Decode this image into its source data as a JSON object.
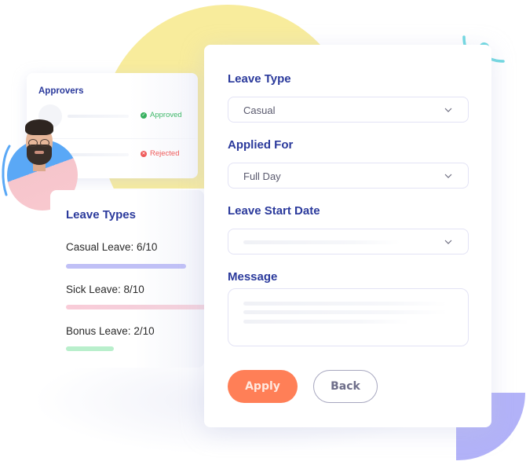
{
  "colors": {
    "heading": "#2b3a9c",
    "apply_button": "#ff7f57",
    "approved": "#36b05e",
    "rejected": "#ef5a5a",
    "decor_yellow": "#f8ec9c",
    "decor_purple": "#b2b2f8",
    "decor_squiggle": "#6fd8e0"
  },
  "approvers": {
    "title": "Approvers",
    "rows": [
      {
        "status": "Approved",
        "status_icon": "check-circle-icon"
      },
      {
        "status": "Rejected",
        "status_icon": "x-circle-icon"
      }
    ]
  },
  "leave_types": {
    "title": "Leave Types",
    "items": [
      {
        "label": "Casual Leave: 6/10",
        "used": 6,
        "total": 10
      },
      {
        "label": "Sick Leave: 8/10",
        "used": 8,
        "total": 10
      },
      {
        "label": "Bonus Leave: 2/10",
        "used": 2,
        "total": 10
      }
    ]
  },
  "form": {
    "leave_type": {
      "label": "Leave Type",
      "value": "Casual"
    },
    "applied_for": {
      "label": "Applied For",
      "value": "Full Day"
    },
    "leave_start_date": {
      "label": "Leave Start Date",
      "value": ""
    },
    "message": {
      "label": "Message",
      "value": ""
    },
    "apply_label": "Apply",
    "back_label": "Back"
  }
}
